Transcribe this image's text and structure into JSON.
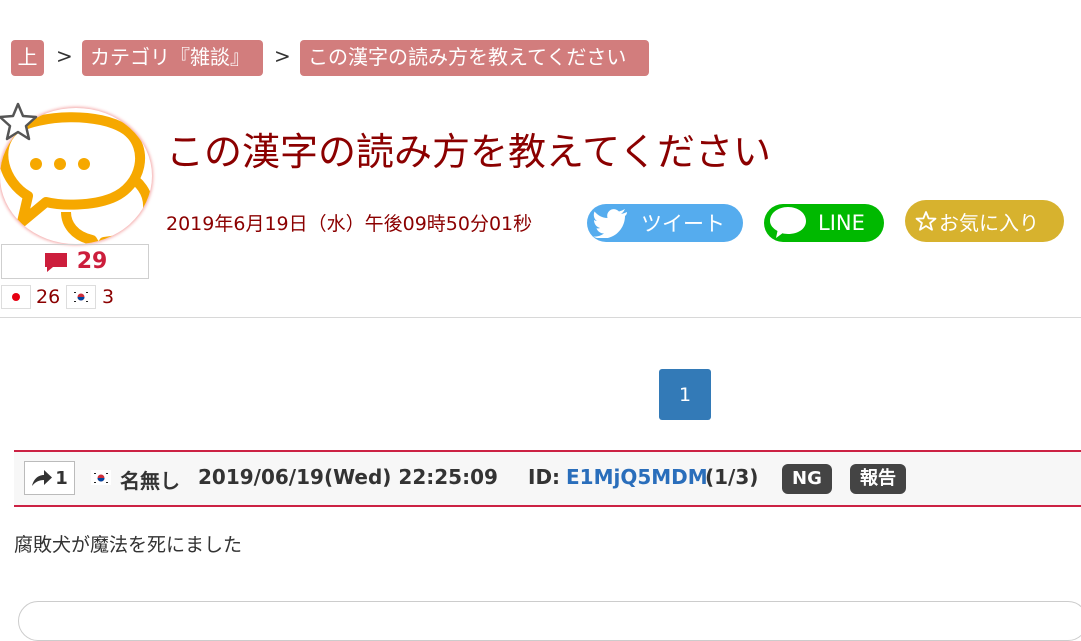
{
  "breadcrumb": {
    "home": "上",
    "separator": ">",
    "category": "カテゴリ『雑談』",
    "current": "この漢字の読み方を教えてください"
  },
  "thread": {
    "title": "この漢字の読み方を教えてください",
    "date": "2019年6月19日（水）午後09時50分01秒",
    "comment_count": "29",
    "jp_count": "26",
    "kr_count": "3"
  },
  "share": {
    "tweet_label": "ツイート",
    "line_label": "LINE",
    "favorite_label": "お気に入り"
  },
  "pagination": {
    "current_page": "1"
  },
  "post": {
    "number": "1",
    "name": "名無し",
    "datetime": "2019/06/19(Wed) 22:25:09",
    "id_label": "ID:",
    "id_value": "E1MjQ5MDM",
    "id_count": "(1/3)",
    "ng_label": "NG",
    "report_label": "報告",
    "body": "腐敗犬が魔法を死にました"
  },
  "colors": {
    "crumb": "#d27d7d",
    "title": "#8b0000",
    "twitter": "#55acee",
    "line": "#00b900",
    "favorite": "#d7b22e",
    "page_active": "#337ab7",
    "post_border": "#cc2244",
    "id_link": "#2a6ebb",
    "avatar_orange": "#f6a800"
  },
  "icons": [
    "star-icon",
    "chat-bubble-icon",
    "comment-icon",
    "jp-flag-icon",
    "kr-flag-icon",
    "twitter-bird-icon",
    "line-logo-icon",
    "reply-arrow-icon"
  ]
}
